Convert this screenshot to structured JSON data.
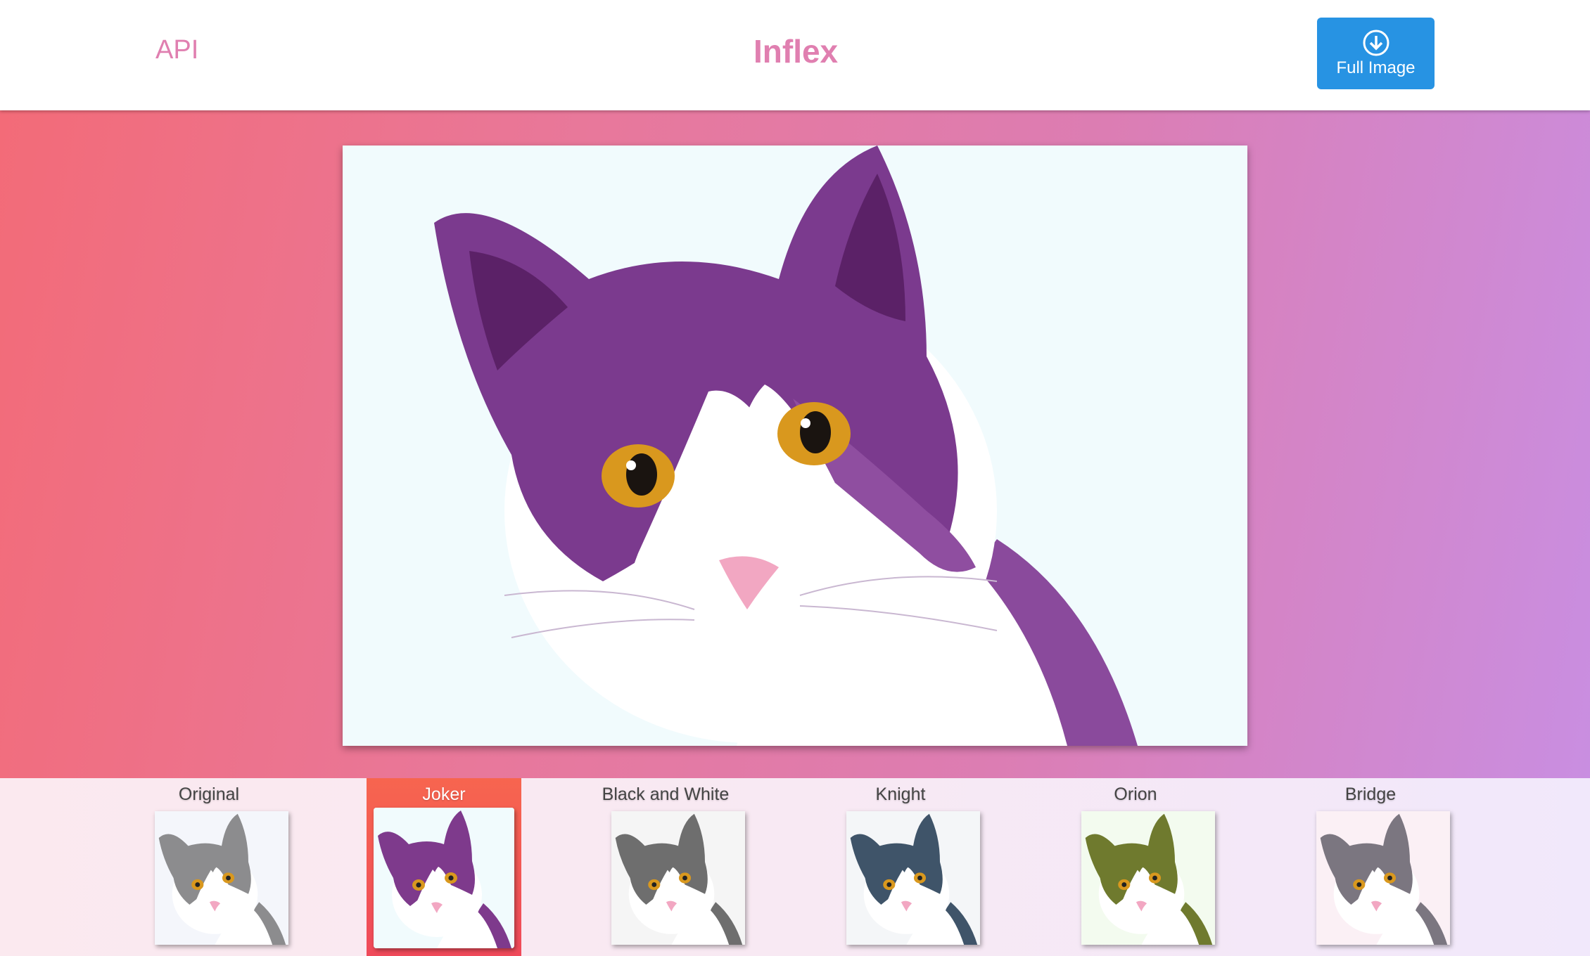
{
  "header": {
    "api_label": "API",
    "brand": "Inflex",
    "full_image_label": "Full Image"
  },
  "main_image": {
    "filter": "Joker"
  },
  "filters": [
    {
      "label": "Original",
      "fur": "#8c8c8e",
      "bg": "#f4f6fb"
    },
    {
      "label": "Joker",
      "fur": "#7e3a8c",
      "bg": "#f1fbfd",
      "active": true
    },
    {
      "label": "Black and White",
      "fur": "#6e6e6e",
      "bg": "#f5f5f5"
    },
    {
      "label": "Knight",
      "fur": "#3f5469",
      "bg": "#f4f6f8"
    },
    {
      "label": "Orion",
      "fur": "#6f7a2e",
      "bg": "#f3fbef"
    },
    {
      "label": "Bridge",
      "fur": "#7b7680",
      "bg": "#fbf0f5"
    }
  ],
  "colors": {
    "brand": "#e07fb0",
    "button": "#2793e3",
    "active_filter": "#ef4a5a"
  }
}
